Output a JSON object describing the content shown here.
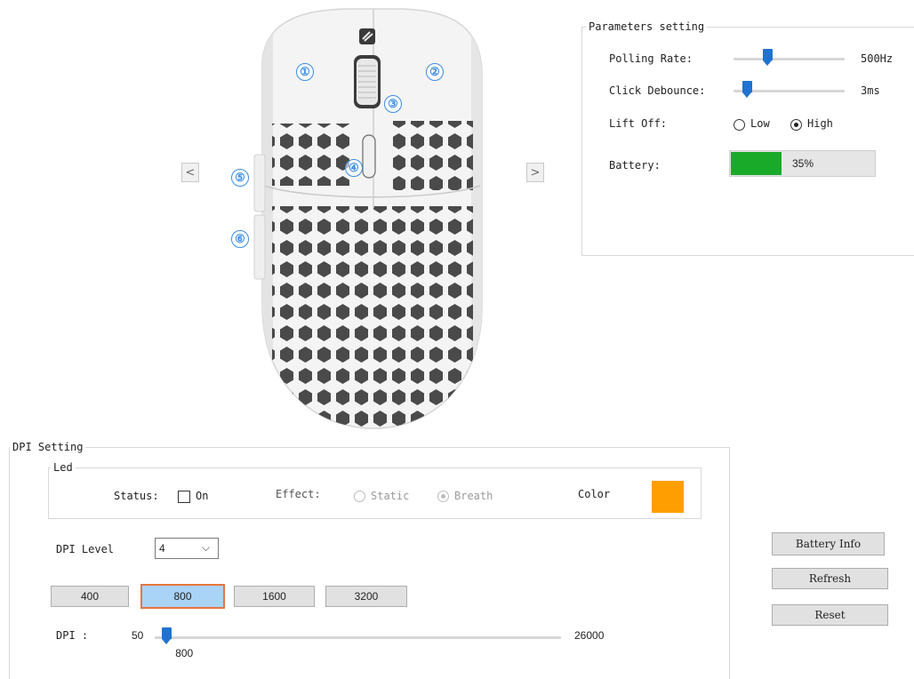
{
  "colors": {
    "accent": "#1e73d1",
    "battery_fill": "#1aaa2a",
    "led_color": "#ff9e00",
    "selected_dpi_border": "#e8743b",
    "selected_dpi_fill": "#a9d3f7",
    "callout": "#3b8ee6"
  },
  "mouse_view": {
    "prev_label": "<",
    "next_label": ">",
    "callouts": [
      "①",
      "②",
      "③",
      "④",
      "⑤",
      "⑥"
    ]
  },
  "parameters": {
    "title": "Parameters setting",
    "polling_rate": {
      "label": "Polling Rate:",
      "value": "500Hz",
      "level": 0.3
    },
    "click_debounce": {
      "label": "Click Debounce:",
      "value": "3ms",
      "level": 0.12
    },
    "lift_off": {
      "label": "Lift Off:",
      "options": [
        "Low",
        "High"
      ],
      "selected": "High"
    },
    "battery": {
      "label": "Battery:",
      "value": "35%",
      "percent": 35
    }
  },
  "dpi_setting": {
    "title": "DPI Setting",
    "led": {
      "title": "Led",
      "status_label": "Status:",
      "status_checkbox_label": "On",
      "status_checked": false,
      "effect_label": "Effect:",
      "effect_options": [
        "Static",
        "Breath"
      ],
      "effect_selected": "Breath",
      "color_label": "Color"
    },
    "level_label": "DPI Level",
    "level_value": "4",
    "presets": [
      "400",
      "800",
      "1600",
      "3200"
    ],
    "selected_preset": "800",
    "dpi_label": "DPI :",
    "min": "50",
    "max": "26000",
    "current": "800"
  },
  "buttons": {
    "battery_info": "Battery Info",
    "refresh": "Refresh",
    "reset": "Reset"
  }
}
